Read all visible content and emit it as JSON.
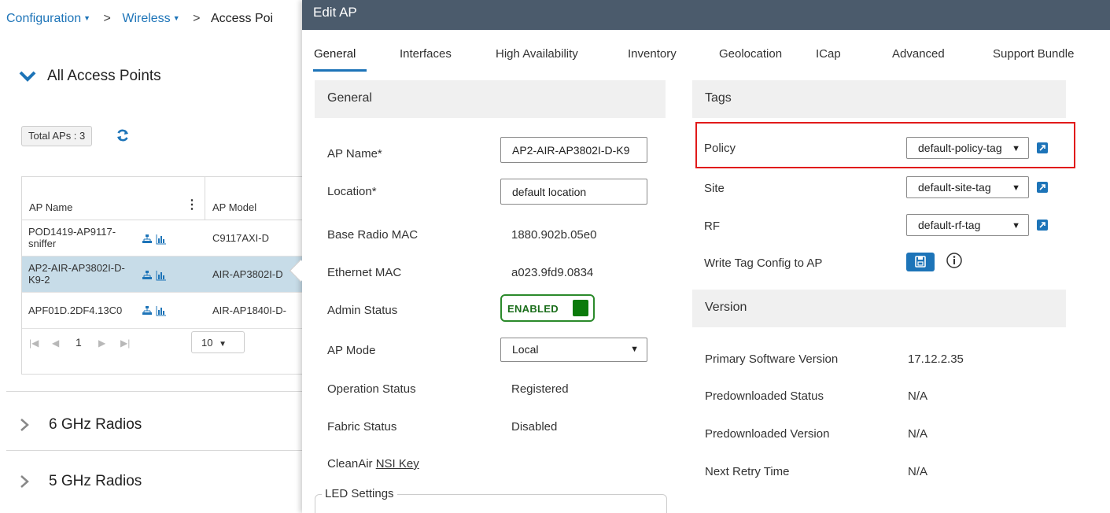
{
  "breadcrumb": {
    "items": [
      "Configuration",
      "Wireless",
      "Access Poi"
    ]
  },
  "left": {
    "section_title": "All Access Points",
    "total_aps": "Total APs : 3",
    "table": {
      "col1": "AP Name",
      "col2": "AP Model",
      "rows": [
        {
          "name": "POD1419-AP9117-sniffer",
          "name_l1": "POD1419-AP9117-",
          "name_l2": "sniffer",
          "model": "C9117AXI-D"
        },
        {
          "name": "AP2-AIR-AP3802I-D-K9-2",
          "name_l1": "AP2-AIR-AP3802I-D-",
          "name_l2": "K9-2",
          "model": "AIR-AP3802I-D"
        },
        {
          "name": "APF01D.2DF4.13C0",
          "name_l1": "APF01D.2DF4.13C0",
          "name_l2": "",
          "model": "AIR-AP1840I-D-"
        }
      ],
      "page": "1",
      "page_size": "10"
    },
    "radios": [
      "6 GHz Radios",
      "5 GHz Radios"
    ]
  },
  "modal": {
    "title": "Edit AP",
    "tabs": [
      "General",
      "Interfaces",
      "High Availability",
      "Inventory",
      "Geolocation",
      "ICap",
      "Advanced",
      "Support Bundle"
    ],
    "active_tab": "General",
    "general": {
      "heading": "General",
      "ap_name_label": "AP Name*",
      "ap_name_value": "AP2-AIR-AP3802I-D-K9",
      "location_label": "Location*",
      "location_value": "default location",
      "base_mac_label": "Base Radio MAC",
      "base_mac_value": "1880.902b.05e0",
      "eth_mac_label": "Ethernet MAC",
      "eth_mac_value": "a023.9fd9.0834",
      "admin_label": "Admin Status",
      "admin_value": "ENABLED",
      "ap_mode_label": "AP Mode",
      "ap_mode_value": "Local",
      "op_status_label": "Operation Status",
      "op_status_value": "Registered",
      "fabric_label": "Fabric Status",
      "fabric_value": "Disabled",
      "cleanair_label": "CleanAir",
      "cleanair_link": "NSI Key",
      "led_legend": "LED Settings"
    },
    "tags": {
      "heading": "Tags",
      "policy_label": "Policy",
      "policy_value": "default-policy-tag",
      "site_label": "Site",
      "site_value": "default-site-tag",
      "rf_label": "RF",
      "rf_value": "default-rf-tag",
      "write_label": "Write Tag Config to AP"
    },
    "version": {
      "heading": "Version",
      "primary_label": "Primary Software Version",
      "primary_value": "17.12.2.35",
      "predl_status_label": "Predownloaded Status",
      "predl_status_value": "N/A",
      "predl_version_label": "Predownloaded Version",
      "predl_version_value": "N/A",
      "retry_label": "Next Retry Time",
      "retry_value": "N/A"
    }
  },
  "colors": {
    "link": "#1d74b8",
    "header_bar": "#4b5b6c",
    "highlight_box": "#e11a1a",
    "enabled_green": "#0b7a0b",
    "selected_row": "#c7dce8"
  }
}
